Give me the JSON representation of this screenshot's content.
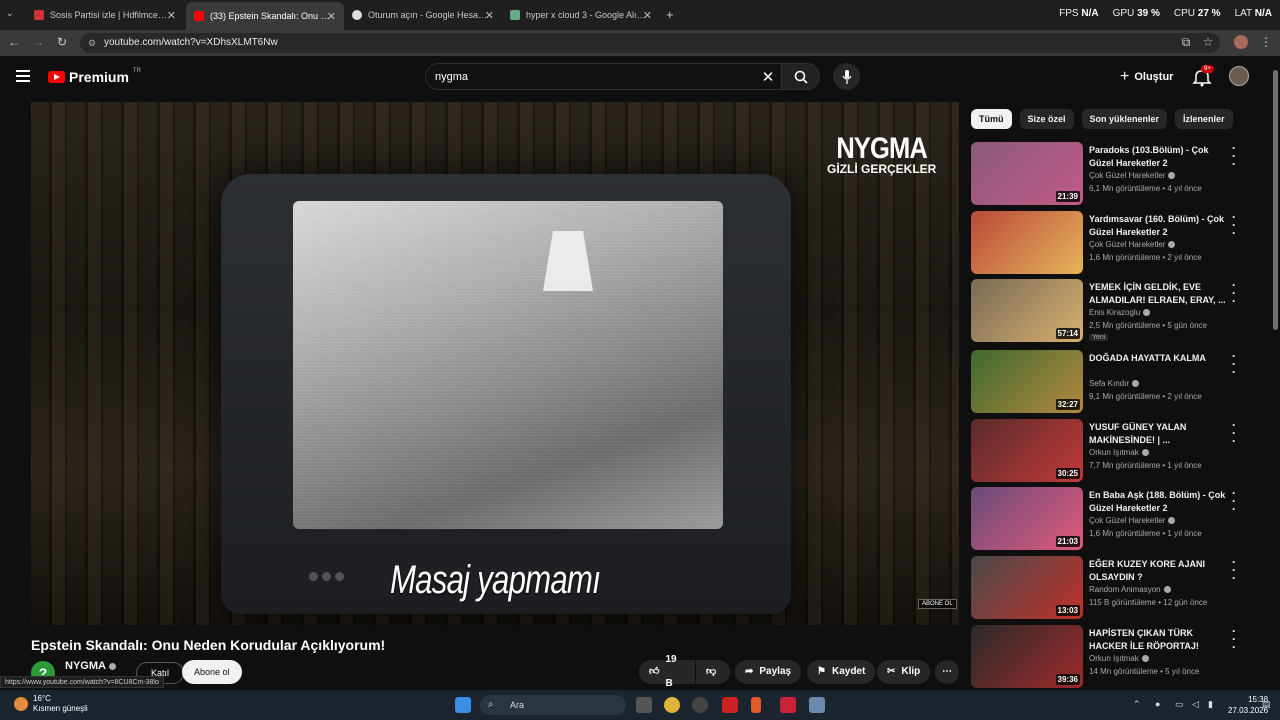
{
  "browser": {
    "tabs": [
      {
        "label": "Sosis Partisi izle | Hdfilmcehennemi",
        "color": "#c33"
      },
      {
        "label": "(33) Epstein Skandalı: Onu Neden Korudular",
        "color": "#f00",
        "active": true
      },
      {
        "label": "Oturum açın - Google Hesapları",
        "color": "#ddd"
      },
      {
        "label": "hyper x cloud 3 - Google Alışveriş",
        "color": "#6a8"
      }
    ],
    "url": "youtube.com/watch?v=XDhsXLMT6Nw",
    "stats": {
      "fps_label": "FPS",
      "fps": "N/A",
      "gpu_label": "GPU",
      "gpu": "39 %",
      "cpu_label": "CPU",
      "cpu": "27 %",
      "lat_label": "LAT",
      "lat": "N/A"
    }
  },
  "header": {
    "brand": "Premium",
    "region": "TR",
    "search_value": "nygma",
    "create_label": "Oluştur",
    "notif_count": "9+"
  },
  "player": {
    "subtitle": "Masaj yapmamı",
    "channel_logo": "NYGMA",
    "channel_logo_sub": "GİZLİ GERÇEKLER",
    "subscribe_overlay": "ABONE OL"
  },
  "video": {
    "title": "Epstein Skandalı: Onu Neden Korudular Açıklıyorum!",
    "channel": "NYGMA",
    "join_label": "Katıl",
    "subscribe_label": "Abone ol",
    "likes": "19 B",
    "share_label": "Paylaş",
    "save_label": "Kaydet",
    "clip_label": "Klip"
  },
  "status_url": "https://www.youtube.com/watch?v=8CU8Cm-38lo",
  "sidebar": {
    "chips": [
      "Tümü",
      "Size özel",
      "Son yüklenenler",
      "İzlenenler"
    ],
    "items": [
      {
        "title": "Paradoks (103.Bölüm) - Çok Güzel Hareketler 2",
        "channel": "Çok Güzel Hareketler",
        "meta": "6,1 Mn görüntüleme • 4 yıl önce",
        "duration": "21:39",
        "badge": "",
        "c1": "#8a5a7a",
        "c2": "#c25a86"
      },
      {
        "title": "Yardımsavar (160. Bölüm) - Çok Güzel Hareketler 2",
        "channel": "Çok Güzel Hareketler",
        "meta": "1,6 Mn görüntüleme • 2 yıl önce",
        "duration": "",
        "badge": "",
        "c1": "#b84a3a",
        "c2": "#e7b35a"
      },
      {
        "title": "YEMEK İÇİN GELDİK, EVE ALMADILAR! ELRAEN, ERAY, ...",
        "channel": "Enis Kirazoglu",
        "meta": "2,5 Mn görüntüleme • 5 gün önce",
        "duration": "57:14",
        "badge": "Yeni",
        "c1": "#7a6a55",
        "c2": "#d8b070"
      },
      {
        "title": "DOĞADA HAYATTA KALMA",
        "channel": "Sefa Kındır",
        "meta": "9,1 Mn görüntüleme • 2 yıl önce",
        "duration": "32:27",
        "badge": "",
        "c1": "#3e6a2e",
        "c2": "#b48840"
      },
      {
        "title": "YUSUF GÜNEY YALAN MAKİNESİNDE! | ...",
        "channel": "Orkun Işıtmak",
        "meta": "7,7 Mn görüntüleme • 1 yıl önce",
        "duration": "30:25",
        "badge": "",
        "c1": "#5a2a2a",
        "c2": "#c23a3a"
      },
      {
        "title": "En Baba Aşk (188. Bölüm) - Çok Güzel Hareketler 2",
        "channel": "Çok Güzel Hareketler",
        "meta": "1,6 Mn görüntüleme • 1 yıl önce",
        "duration": "21:03",
        "badge": "",
        "c1": "#6a4a7a",
        "c2": "#e05a7a"
      },
      {
        "title": "EĞER KUZEY KORE AJANI OLSAYDIN ?",
        "channel": "Random Animasyon",
        "meta": "115 B görüntüleme • 12 gün önce",
        "duration": "13:03",
        "badge": "",
        "c1": "#4a4a4a",
        "c2": "#c0302a"
      },
      {
        "title": "HAPİSTEN ÇIKAN TÜRK HACKER İLE RÖPORTAJ!",
        "channel": "Orkun Işıtmak",
        "meta": "14 Mn görüntüleme • 5 yıl önce",
        "duration": "39:36",
        "badge": "",
        "c1": "#2a2a2a",
        "c2": "#a02a2a"
      }
    ]
  },
  "taskbar": {
    "temp": "16°C",
    "weather": "Kısmen güneşli",
    "search": "Ara",
    "time": "15:38",
    "date": "27.03.2026"
  }
}
